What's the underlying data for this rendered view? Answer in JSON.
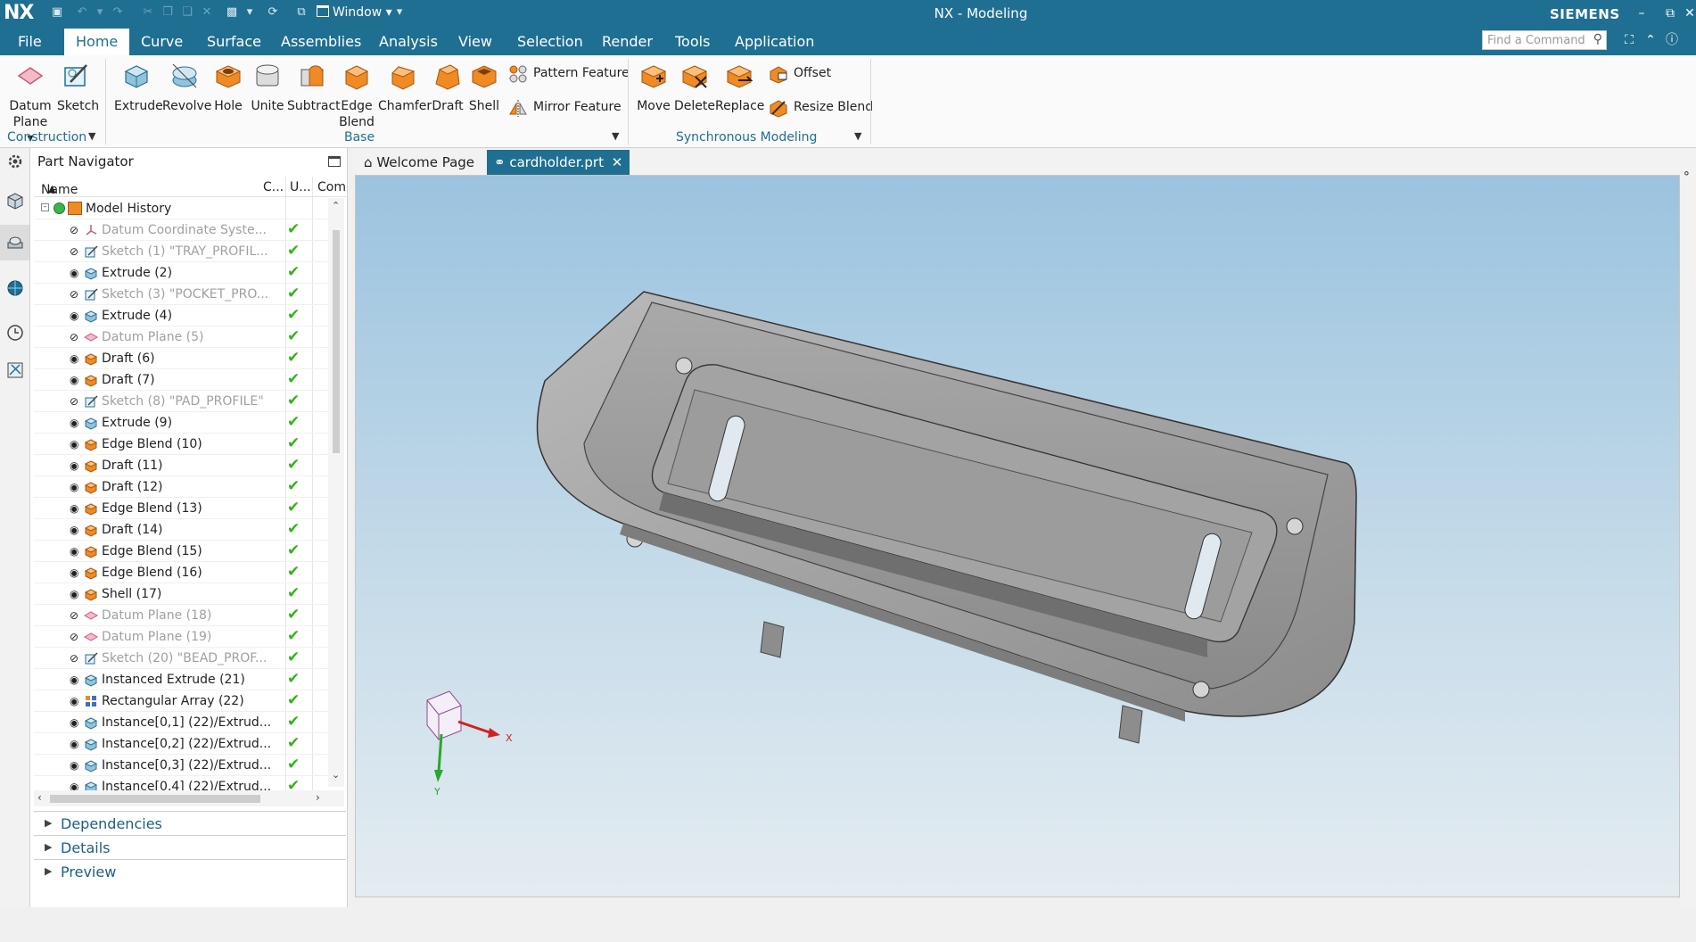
{
  "title_bar": {
    "logo": "NX",
    "window_menu": "Window",
    "app_title": "NX - Modeling",
    "brand": "SIEMENS"
  },
  "menu": {
    "items": [
      "File",
      "Home",
      "Curve",
      "Surface",
      "Assemblies",
      "Analysis",
      "View",
      "Selection",
      "Render",
      "Tools",
      "Application"
    ],
    "active": "Home",
    "search_placeholder": "Find a Command"
  },
  "ribbon": {
    "construction": {
      "label": "Construction",
      "datum_plane_1": "Datum",
      "datum_plane_2": "Plane",
      "sketch": "Sketch"
    },
    "base": {
      "label": "Base",
      "extrude": "Extrude",
      "revolve": "Revolve",
      "hole": "Hole",
      "unite": "Unite",
      "subtract": "Subtract",
      "edge_blend_1": "Edge",
      "edge_blend_2": "Blend",
      "chamfer": "Chamfer",
      "draft": "Draft",
      "shell": "Shell",
      "pattern_feature": "Pattern Feature",
      "mirror_feature": "Mirror Feature"
    },
    "sync": {
      "label": "Synchronous Modeling",
      "move": "Move",
      "delete": "Delete",
      "replace": "Replace",
      "offset": "Offset",
      "resize_blend": "Resize Blend"
    }
  },
  "navigator": {
    "title": "Part Navigator",
    "columns": {
      "name": "Name",
      "c": "C...",
      "u": "U...",
      "com": "Com"
    },
    "root": "Model History",
    "rows": [
      {
        "label": "Datum Coordinate Syste...",
        "kind": "csys",
        "dim": true
      },
      {
        "label": "Sketch (1) \"TRAY_PROFIL...",
        "kind": "sketch",
        "dim": true
      },
      {
        "label": "Extrude (2)",
        "kind": "extrude",
        "dim": false
      },
      {
        "label": "Sketch (3) \"POCKET_PRO...",
        "kind": "sketch",
        "dim": true
      },
      {
        "label": "Extrude (4)",
        "kind": "extrude",
        "dim": false
      },
      {
        "label": "Datum Plane (5)",
        "kind": "datum",
        "dim": true
      },
      {
        "label": "Draft (6)",
        "kind": "draft",
        "dim": false
      },
      {
        "label": "Draft (7)",
        "kind": "draft",
        "dim": false
      },
      {
        "label": "Sketch (8) \"PAD_PROFILE\"",
        "kind": "sketch",
        "dim": true
      },
      {
        "label": "Extrude (9)",
        "kind": "extrude",
        "dim": false
      },
      {
        "label": "Edge Blend (10)",
        "kind": "draft",
        "dim": false
      },
      {
        "label": "Draft (11)",
        "kind": "draft",
        "dim": false
      },
      {
        "label": "Draft (12)",
        "kind": "draft",
        "dim": false
      },
      {
        "label": "Edge Blend (13)",
        "kind": "draft",
        "dim": false
      },
      {
        "label": "Draft (14)",
        "kind": "draft",
        "dim": false
      },
      {
        "label": "Edge Blend (15)",
        "kind": "draft",
        "dim": false
      },
      {
        "label": "Edge Blend (16)",
        "kind": "draft",
        "dim": false
      },
      {
        "label": "Shell (17)",
        "kind": "draft",
        "dim": false
      },
      {
        "label": "Datum Plane (18)",
        "kind": "datum",
        "dim": true
      },
      {
        "label": "Datum Plane (19)",
        "kind": "datum",
        "dim": true
      },
      {
        "label": "Sketch (20) \"BEAD_PROF...",
        "kind": "sketch",
        "dim": true
      },
      {
        "label": "Instanced Extrude (21)",
        "kind": "extrude",
        "dim": false
      },
      {
        "label": "Rectangular Array (22)",
        "kind": "array",
        "dim": false
      },
      {
        "label": "Instance[0,1] (22)/Extrud...",
        "kind": "extrude",
        "dim": false
      },
      {
        "label": "Instance[0,2] (22)/Extrud...",
        "kind": "extrude",
        "dim": false
      },
      {
        "label": "Instance[0,3] (22)/Extrud...",
        "kind": "extrude",
        "dim": false
      },
      {
        "label": "Instance[0,4] (22)/Extrud...",
        "kind": "extrude",
        "dim": false
      }
    ],
    "sections": [
      "Dependencies",
      "Details",
      "Preview"
    ]
  },
  "tabs": [
    {
      "label": "Welcome Page",
      "active": false
    },
    {
      "label": "cardholder.prt",
      "active": true
    }
  ],
  "viewport": {
    "axis_x": "X",
    "axis_y": "Y"
  },
  "colors": {
    "accent": "#1f6f92",
    "feature_orange": "#f08a24",
    "check_green": "#33b21c"
  }
}
